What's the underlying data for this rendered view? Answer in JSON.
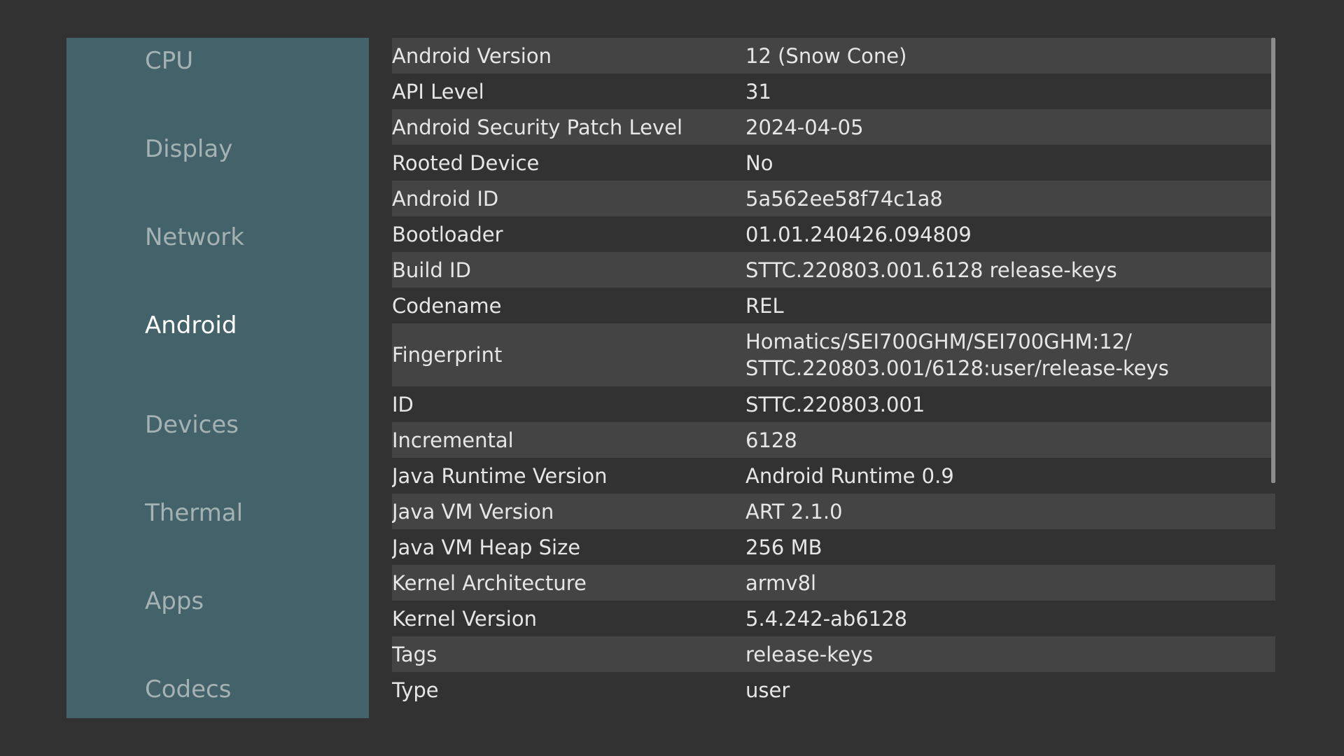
{
  "nav": {
    "items": [
      {
        "label": "CPU",
        "active": false
      },
      {
        "label": "Display",
        "active": false
      },
      {
        "label": "Network",
        "active": false
      },
      {
        "label": "Android",
        "active": true
      },
      {
        "label": "Devices",
        "active": false
      },
      {
        "label": "Thermal",
        "active": false
      },
      {
        "label": "Apps",
        "active": false
      },
      {
        "label": "Codecs",
        "active": false
      }
    ]
  },
  "details": {
    "rows": [
      {
        "key": "Android Version",
        "value": "12 (Snow Cone)"
      },
      {
        "key": "API Level",
        "value": "31"
      },
      {
        "key": "Android Security Patch Level",
        "value": "2024-04-05"
      },
      {
        "key": "Rooted Device",
        "value": "No"
      },
      {
        "key": "Android ID",
        "value": "5a562ee58f74c1a8"
      },
      {
        "key": "Bootloader",
        "value": "01.01.240426.094809"
      },
      {
        "key": "Build ID",
        "value": "STTC.220803.001.6128 release-keys"
      },
      {
        "key": "Codename",
        "value": "REL"
      },
      {
        "key": "Fingerprint",
        "value": "Homatics/SEI700GHM/SEI700GHM:12/",
        "value2": "STTC.220803.001/6128:user/release-keys"
      },
      {
        "key": "ID",
        "value": "STTC.220803.001"
      },
      {
        "key": "Incremental",
        "value": "6128"
      },
      {
        "key": "Java Runtime Version",
        "value": "Android Runtime 0.9"
      },
      {
        "key": "Java VM Version",
        "value": "ART 2.1.0"
      },
      {
        "key": "Java VM Heap Size",
        "value": "256 MB"
      },
      {
        "key": "Kernel Architecture",
        "value": "armv8l"
      },
      {
        "key": "Kernel Version",
        "value": "5.4.242-ab6128"
      },
      {
        "key": "Tags",
        "value": "release-keys"
      },
      {
        "key": "Type",
        "value": "user"
      }
    ]
  },
  "colors": {
    "background": "#323232",
    "sidebar": "#44626a",
    "row_shade": "#444444",
    "text": "#e6e6e6",
    "nav_inactive": "#a4b2b4",
    "nav_active": "#ffffff"
  }
}
